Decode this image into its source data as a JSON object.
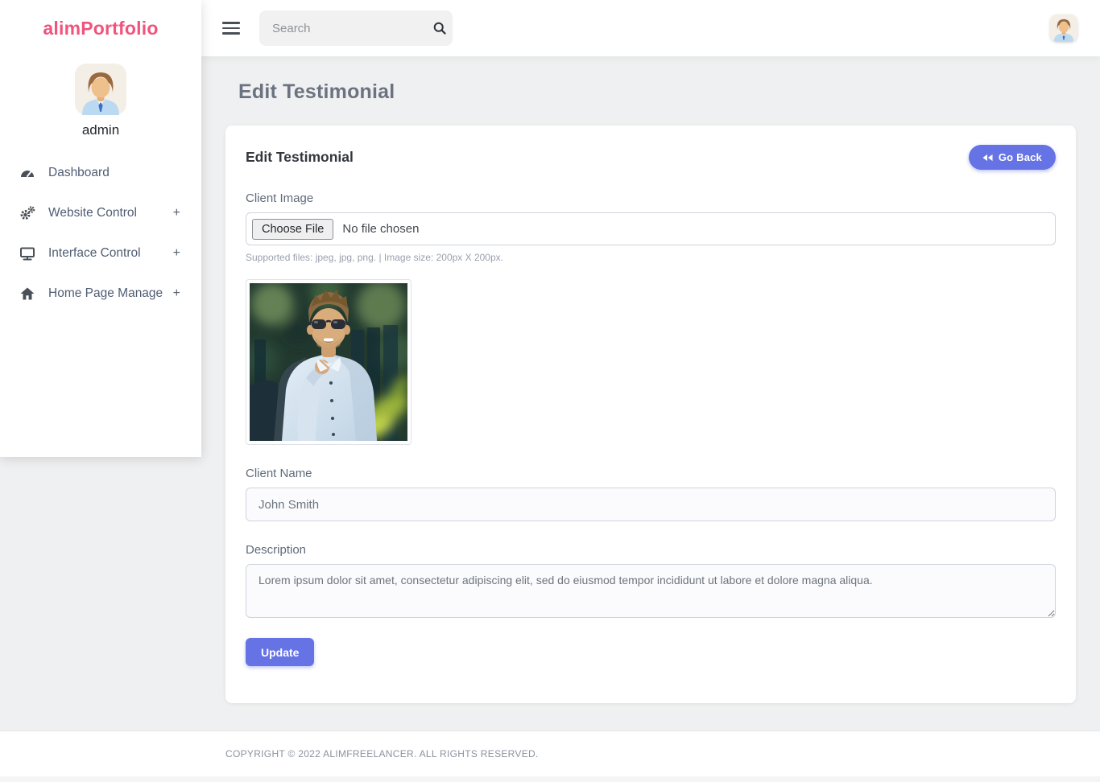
{
  "sidebar": {
    "logo": "alimPortfolio",
    "username": "admin",
    "items": [
      {
        "label": "Dashboard",
        "icon": "tachometer-icon"
      },
      {
        "label": "Website Control",
        "icon": "cogs-icon",
        "plus": "+"
      },
      {
        "label": "Interface Control",
        "icon": "desktop-icon",
        "plus": "+"
      },
      {
        "label": "Home Page Manage",
        "icon": "home-icon",
        "plus": "+"
      }
    ]
  },
  "topbar": {
    "search_placeholder": "Search"
  },
  "page": {
    "title": "Edit Testimonial"
  },
  "card": {
    "title": "Edit Testimonial",
    "go_back_label": "Go Back",
    "form": {
      "client_image_label": "Client Image",
      "file_button_label": "Choose File",
      "file_status": "No file chosen",
      "file_help": "Supported files: jpeg, jpg, png. | Image size: 200px X 200px.",
      "client_name_label": "Client Name",
      "client_name_value": "John Smith",
      "description_label": "Description",
      "description_value": "Lorem ipsum dolor sit amet, consectetur adipiscing elit, sed do eiusmod tempor incididunt ut labore et dolore magna aliqua.",
      "update_label": "Update"
    }
  },
  "footer": {
    "copyright": "COPYRIGHT © 2022 ALIMFREELANCER. ALL RIGHTS RESERVED."
  },
  "colors": {
    "accent": "#6673e5",
    "logo_pink": "#f0537e",
    "background": "#eff0f1"
  }
}
